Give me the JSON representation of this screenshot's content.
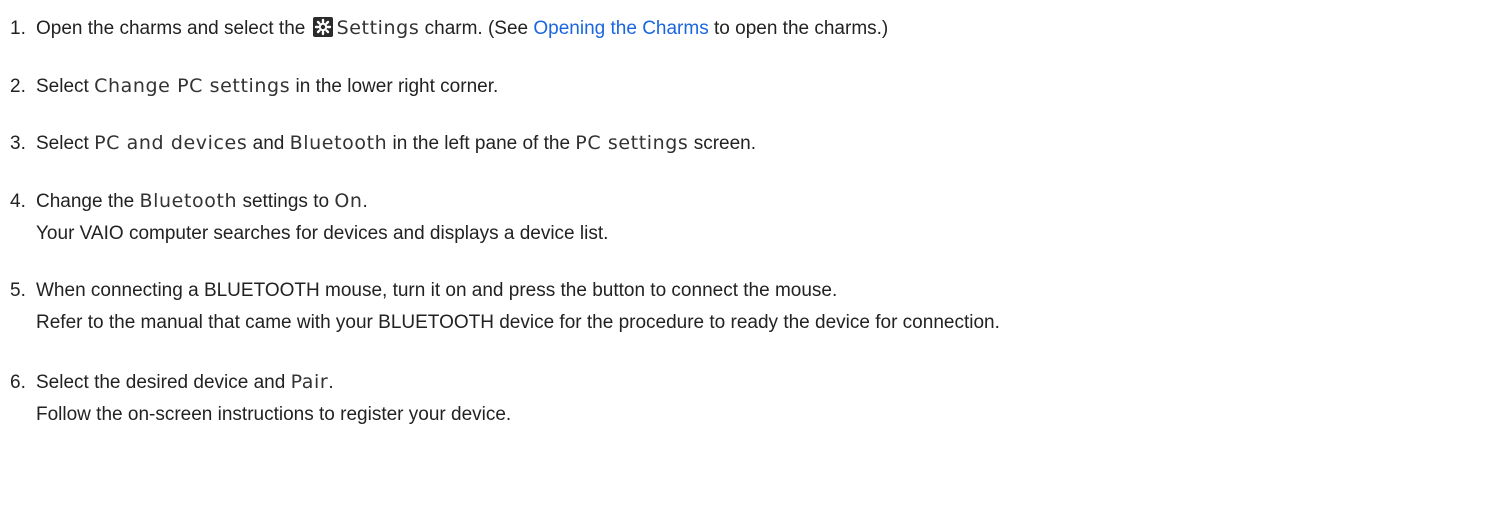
{
  "steps": [
    {
      "num": "1.",
      "parts": {
        "a": "Open the charms and select the",
        "ui": "Settings",
        "b": "charm. (See",
        "link": "Opening the Charms",
        "c": "to open the charms.)"
      },
      "icon": "settings-gear-icon"
    },
    {
      "num": "2.",
      "parts": {
        "a": "Select",
        "ui": "Change PC settings",
        "b": "in the lower right corner."
      }
    },
    {
      "num": "3.",
      "parts": {
        "a": "Select",
        "ui1": "PC and devices",
        "b": "and",
        "ui2": "Bluetooth",
        "c": "in the left pane of the",
        "ui3": "PC settings",
        "d": "screen."
      }
    },
    {
      "num": "4.",
      "parts": {
        "a": "Change the",
        "ui1": "Bluetooth",
        "b": "settings to",
        "ui2": "On",
        "c": "."
      },
      "sub": "Your VAIO computer searches for devices and displays a device list."
    },
    {
      "num": "5.",
      "parts": {
        "a": "When connecting a BLUETOOTH mouse, turn it on and press the button to connect the mouse."
      },
      "sub": "Refer to the manual that came with your BLUETOOTH device for the procedure to ready the device for connection."
    },
    {
      "num": "6.",
      "parts": {
        "a": "Select the desired device and",
        "ui": "Pair",
        "b": "."
      },
      "sub": "Follow the on-screen instructions to register your device."
    }
  ],
  "colors": {
    "link": "#1a66e0",
    "text": "#222222",
    "icon_bg": "#2b2b2b"
  }
}
